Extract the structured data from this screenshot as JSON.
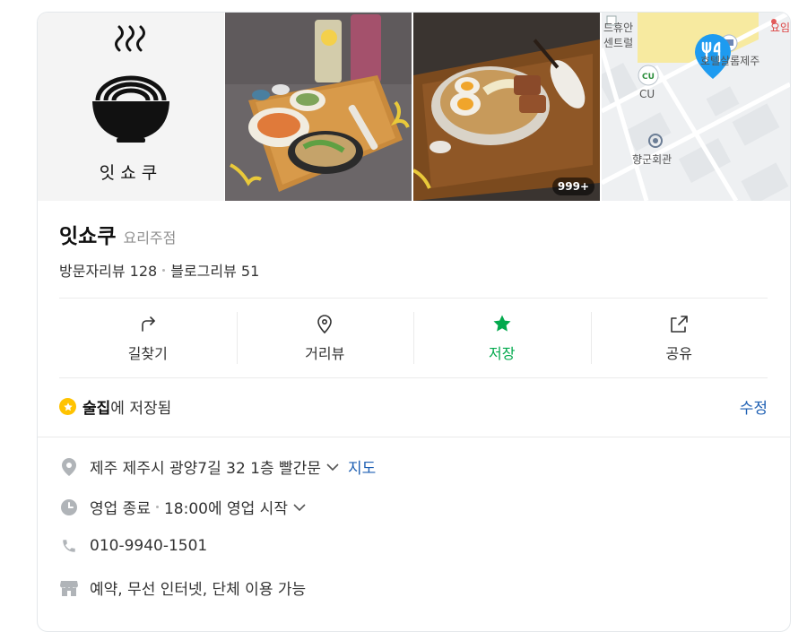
{
  "logo": {
    "text": "잇쇼쿠"
  },
  "photos": {
    "count_badge": "999+"
  },
  "map": {
    "labels": [
      {
        "text": "요임"
      },
      {
        "text": "드휴안"
      },
      {
        "text": "센트럴"
      },
      {
        "text": "호텔살롬제주"
      },
      {
        "text": "CU"
      },
      {
        "text": "향군회관"
      }
    ]
  },
  "place": {
    "name": "잇쇼쿠",
    "category": "요리주점"
  },
  "reviews": {
    "visitor": "방문자리뷰 128",
    "blog": "블로그리뷰 51"
  },
  "actions": [
    {
      "label": "길찾기",
      "icon": "directions-icon"
    },
    {
      "label": "거리뷰",
      "icon": "street-view-icon"
    },
    {
      "label": "저장",
      "icon": "star-icon"
    },
    {
      "label": "공유",
      "icon": "share-icon"
    }
  ],
  "saved": {
    "folder": "술집",
    "suffix": "에 저장됨",
    "edit": "수정"
  },
  "info": {
    "address": "제주 제주시 광양7길 32 1층 빨간문",
    "map_link": "지도",
    "status": "영업 종료",
    "hours": "18:00에 영업 시작",
    "phone": "010-9940-1501",
    "amenities": "예약, 무선 인터넷, 단체 이용 가능"
  },
  "colors": {
    "accent_green": "#03a94d",
    "link_blue": "#1d5fb3",
    "badge_yellow": "#ffc300",
    "map_pin": "#1e9bf0"
  }
}
